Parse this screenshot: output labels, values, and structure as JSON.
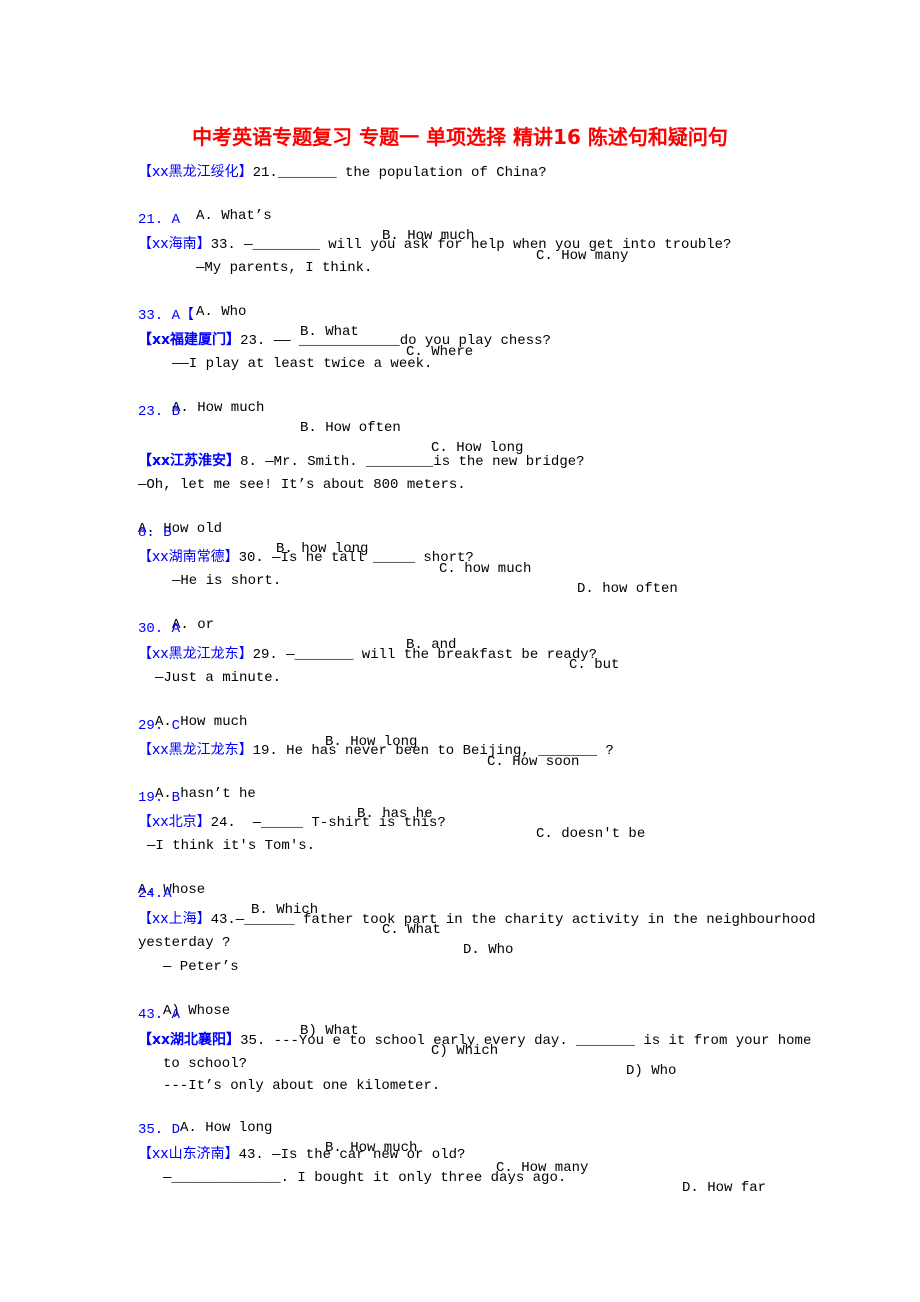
{
  "document": {
    "title": "中考英语专题复习 专题一 单项选择 精讲16 陈述句和疑问句",
    "colors": {
      "title": "#ff0000",
      "source": "#0000ff",
      "answer": "#0000ff",
      "text": "#000000"
    }
  },
  "questions": [
    {
      "source": "【xx黑龙江绥化】",
      "stem": "21._______ the population of China?",
      "reply": "",
      "options": [
        "A. What’s",
        "B. How much",
        "C. How many"
      ],
      "answer": "21. A"
    },
    {
      "source": "【xx海南】",
      "stem": "33. —________ will you ask for help when you get into trouble?",
      "reply": "—My parents, I think.",
      "options": [
        "A. Who",
        "B. What",
        "C. Where"
      ],
      "answer": "33. A【"
    },
    {
      "source": "【xx福建厦门】",
      "stem": "23. —— ____________do you play chess?",
      "reply": "——I play at least twice a week.",
      "options": [
        "A. How much",
        "B. How often",
        "C. How long"
      ],
      "answer": "23. B"
    },
    {
      "source": "【xx江苏淮安】",
      "stem": "8. —Mr. Smith. ________is the new bridge?",
      "reply": "—Oh, let me see! It’s about 800 meters.",
      "options": [
        "A. How old",
        "B. how long",
        "C. how much",
        "D. how often"
      ],
      "answer": "8. B"
    },
    {
      "source": "【xx湖南常德】",
      "stem": "30. —Is he tall _____ short?",
      "reply": "—He is short.",
      "options": [
        "A. or",
        "B. and",
        "C. but"
      ],
      "answer": "30. A"
    },
    {
      "source": "【xx黑龙江龙东】",
      "stem": "29. —_______ will the breakfast be ready?",
      "reply": "—Just a minute.",
      "options": [
        "A. How much",
        "B. How long",
        "C. How soon"
      ],
      "answer": "29. C"
    },
    {
      "source": "【xx黑龙江龙东】",
      "stem": "19. He has never been to Beijing, _______ ?",
      "reply": "",
      "options": [
        "A. hasn’t he",
        "B. has he",
        "C. doesn't be"
      ],
      "answer": "19. B"
    },
    {
      "source": "【xx北京】",
      "stem": "24.  —_____ T-shirt is this?",
      "reply": "—I think it's Tom's.",
      "options": [
        "A. Whose",
        "B. Which",
        "C. What",
        "D. Who"
      ],
      "answer": "24.A"
    },
    {
      "source": "【xx上海】",
      "stem": "43.—______ father took part in the charity activity in the neighbourhood",
      "stem_cont": "yesterday ?",
      "reply": "— Peter’s",
      "options": [
        "A) Whose",
        "B) What",
        "C) Which",
        "D) Who"
      ],
      "answer": "43. A"
    },
    {
      "source": "【xx湖北襄阳】",
      "stem": "35. ---You e to school early every day. _______ is it from your home",
      "stem_cont": "to school?",
      "reply": "---It’s only about one kilometer.",
      "options": [
        "A. How long",
        "B. How much",
        "C. How many",
        "D. How far"
      ],
      "answer": "35. D"
    },
    {
      "source": "【xx山东济南】",
      "stem": "43. —Is the car new or old?",
      "reply": "—_____________. I bought it only three days ago."
    }
  ]
}
